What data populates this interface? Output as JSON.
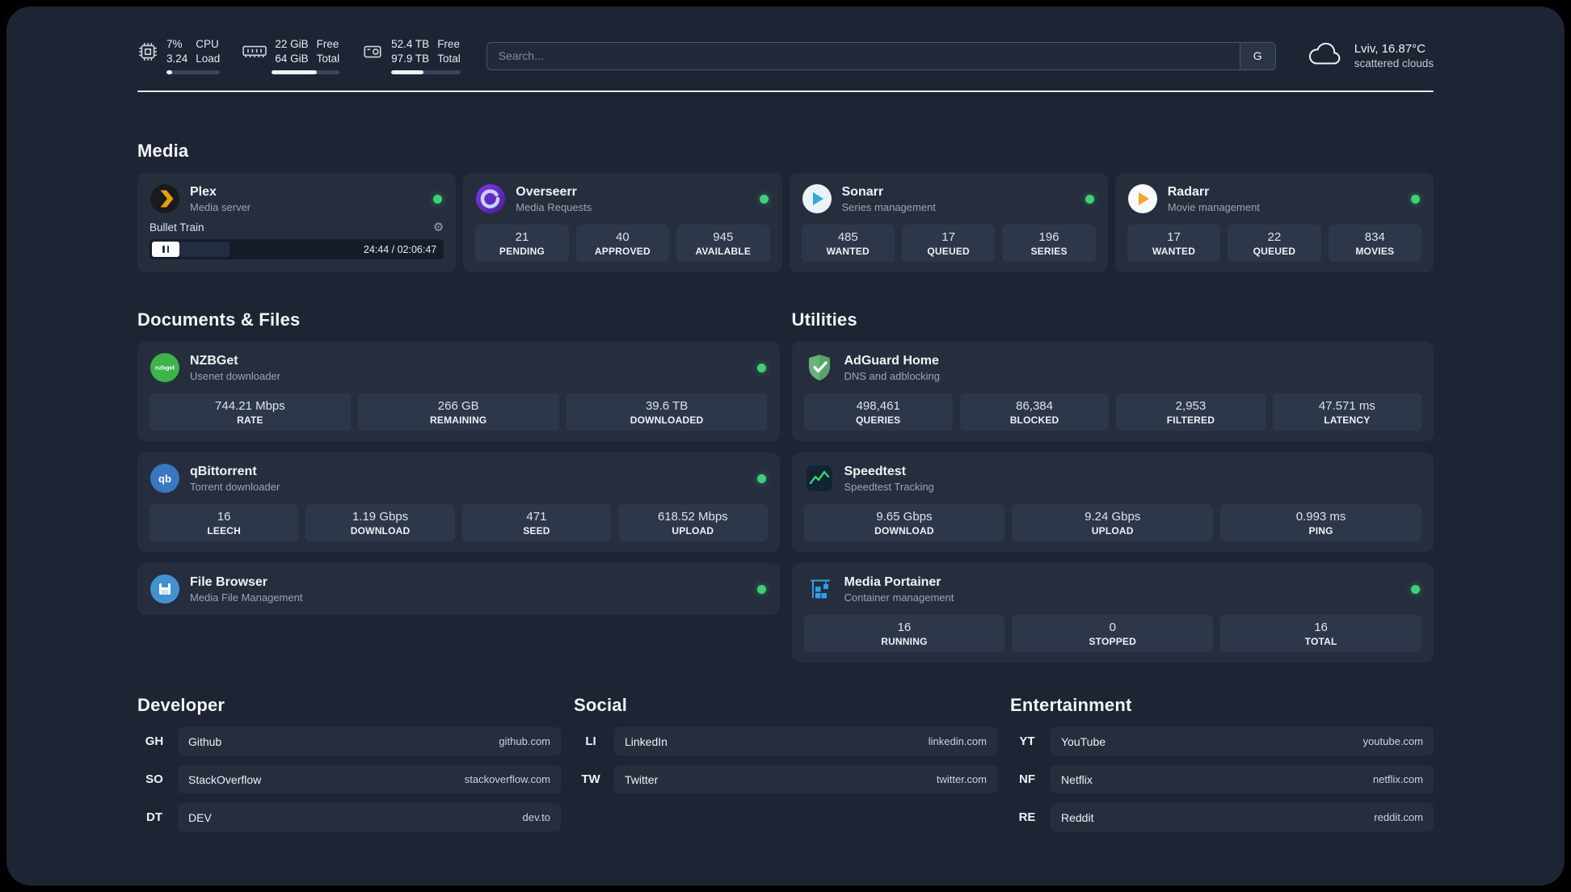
{
  "colors": {
    "status_online": "#3ecf77",
    "background": "#1d2433",
    "card": "#262e3e",
    "stat_tile": "#2d3749"
  },
  "topbar": {
    "cpu": {
      "icon": "cpu-chip-icon",
      "percent": "7%",
      "load": "3.24",
      "label_top": "CPU",
      "label_bottom": "Load",
      "bar_percent": 7
    },
    "ram": {
      "icon": "ram-icon",
      "free": "22 GiB",
      "total": "64 GiB",
      "label_top": "Free",
      "label_bottom": "Total",
      "bar_percent": 66
    },
    "disk": {
      "icon": "disk-icon",
      "free": "52.4 TB",
      "total": "97.9 TB",
      "label_top": "Free",
      "label_bottom": "Total",
      "bar_percent": 46
    },
    "search": {
      "placeholder": "Search...",
      "button_label": "G"
    },
    "weather": {
      "icon": "cloud-icon",
      "location": "Lviv, 16.87°C",
      "condition": "scattered clouds"
    }
  },
  "media": {
    "title": "Media",
    "cards": [
      {
        "icon": "plex-icon",
        "name": "Plex",
        "subtitle": "Media server",
        "online": true,
        "player": {
          "track": "Bullet Train",
          "time": "24:44 / 02:06:47",
          "progress_percent": 19
        }
      },
      {
        "icon": "overseerr-icon",
        "name": "Overseerr",
        "subtitle": "Media Requests",
        "online": true,
        "stats": [
          {
            "value": "21",
            "label": "PENDING"
          },
          {
            "value": "40",
            "label": "APPROVED"
          },
          {
            "value": "945",
            "label": "AVAILABLE"
          }
        ]
      },
      {
        "icon": "sonarr-icon",
        "name": "Sonarr",
        "subtitle": "Series management",
        "online": true,
        "stats": [
          {
            "value": "485",
            "label": "WANTED"
          },
          {
            "value": "17",
            "label": "QUEUED"
          },
          {
            "value": "196",
            "label": "SERIES"
          }
        ]
      },
      {
        "icon": "radarr-icon",
        "name": "Radarr",
        "subtitle": "Movie management",
        "online": true,
        "stats": [
          {
            "value": "17",
            "label": "WANTED"
          },
          {
            "value": "22",
            "label": "QUEUED"
          },
          {
            "value": "834",
            "label": "MOVIES"
          }
        ]
      }
    ]
  },
  "documents": {
    "title": "Documents & Files",
    "cards": [
      {
        "icon": "nzbget-icon",
        "name": "NZBGet",
        "subtitle": "Usenet downloader",
        "online": true,
        "stats": [
          {
            "value": "744.21 Mbps",
            "label": "RATE"
          },
          {
            "value": "266 GB",
            "label": "REMAINING"
          },
          {
            "value": "39.6 TB",
            "label": "DOWNLOADED"
          }
        ]
      },
      {
        "icon": "qbittorrent-icon",
        "name": "qBittorrent",
        "subtitle": "Torrent downloader",
        "online": true,
        "stats": [
          {
            "value": "16",
            "label": "LEECH"
          },
          {
            "value": "1.19 Gbps",
            "label": "DOWNLOAD"
          },
          {
            "value": "471",
            "label": "SEED"
          },
          {
            "value": "618.52 Mbps",
            "label": "UPLOAD"
          }
        ]
      },
      {
        "icon": "filebrowser-icon",
        "name": "File Browser",
        "subtitle": "Media File Management",
        "online": true,
        "stats": []
      }
    ]
  },
  "utilities": {
    "title": "Utilities",
    "cards": [
      {
        "icon": "adguard-icon",
        "name": "AdGuard Home",
        "subtitle": "DNS and adblocking",
        "online": false,
        "stats": [
          {
            "value": "498,461",
            "label": "QUERIES"
          },
          {
            "value": "86,384",
            "label": "BLOCKED"
          },
          {
            "value": "2,953",
            "label": "FILTERED"
          },
          {
            "value": "47.571 ms",
            "label": "LATENCY"
          }
        ]
      },
      {
        "icon": "speedtest-icon",
        "name": "Speedtest",
        "subtitle": "Speedtest Tracking",
        "online": false,
        "stats": [
          {
            "value": "9.65 Gbps",
            "label": "DOWNLOAD"
          },
          {
            "value": "9.24 Gbps",
            "label": "UPLOAD"
          },
          {
            "value": "0.993 ms",
            "label": "PING"
          }
        ]
      },
      {
        "icon": "portainer-icon",
        "name": "Media Portainer",
        "subtitle": "Container management",
        "online": true,
        "stats": [
          {
            "value": "16",
            "label": "RUNNING"
          },
          {
            "value": "0",
            "label": "STOPPED"
          },
          {
            "value": "16",
            "label": "TOTAL"
          }
        ]
      }
    ]
  },
  "link_groups": [
    {
      "title": "Developer",
      "items": [
        {
          "abbr": "GH",
          "name": "Github",
          "url": "github.com"
        },
        {
          "abbr": "SO",
          "name": "StackOverflow",
          "url": "stackoverflow.com"
        },
        {
          "abbr": "DT",
          "name": "DEV",
          "url": "dev.to"
        }
      ]
    },
    {
      "title": "Social",
      "items": [
        {
          "abbr": "LI",
          "name": "LinkedIn",
          "url": "linkedin.com"
        },
        {
          "abbr": "TW",
          "name": "Twitter",
          "url": "twitter.com"
        }
      ]
    },
    {
      "title": "Entertainment",
      "items": [
        {
          "abbr": "YT",
          "name": "YouTube",
          "url": "youtube.com"
        },
        {
          "abbr": "NF",
          "name": "Netflix",
          "url": "netflix.com"
        },
        {
          "abbr": "RE",
          "name": "Reddit",
          "url": "reddit.com"
        }
      ]
    }
  ]
}
